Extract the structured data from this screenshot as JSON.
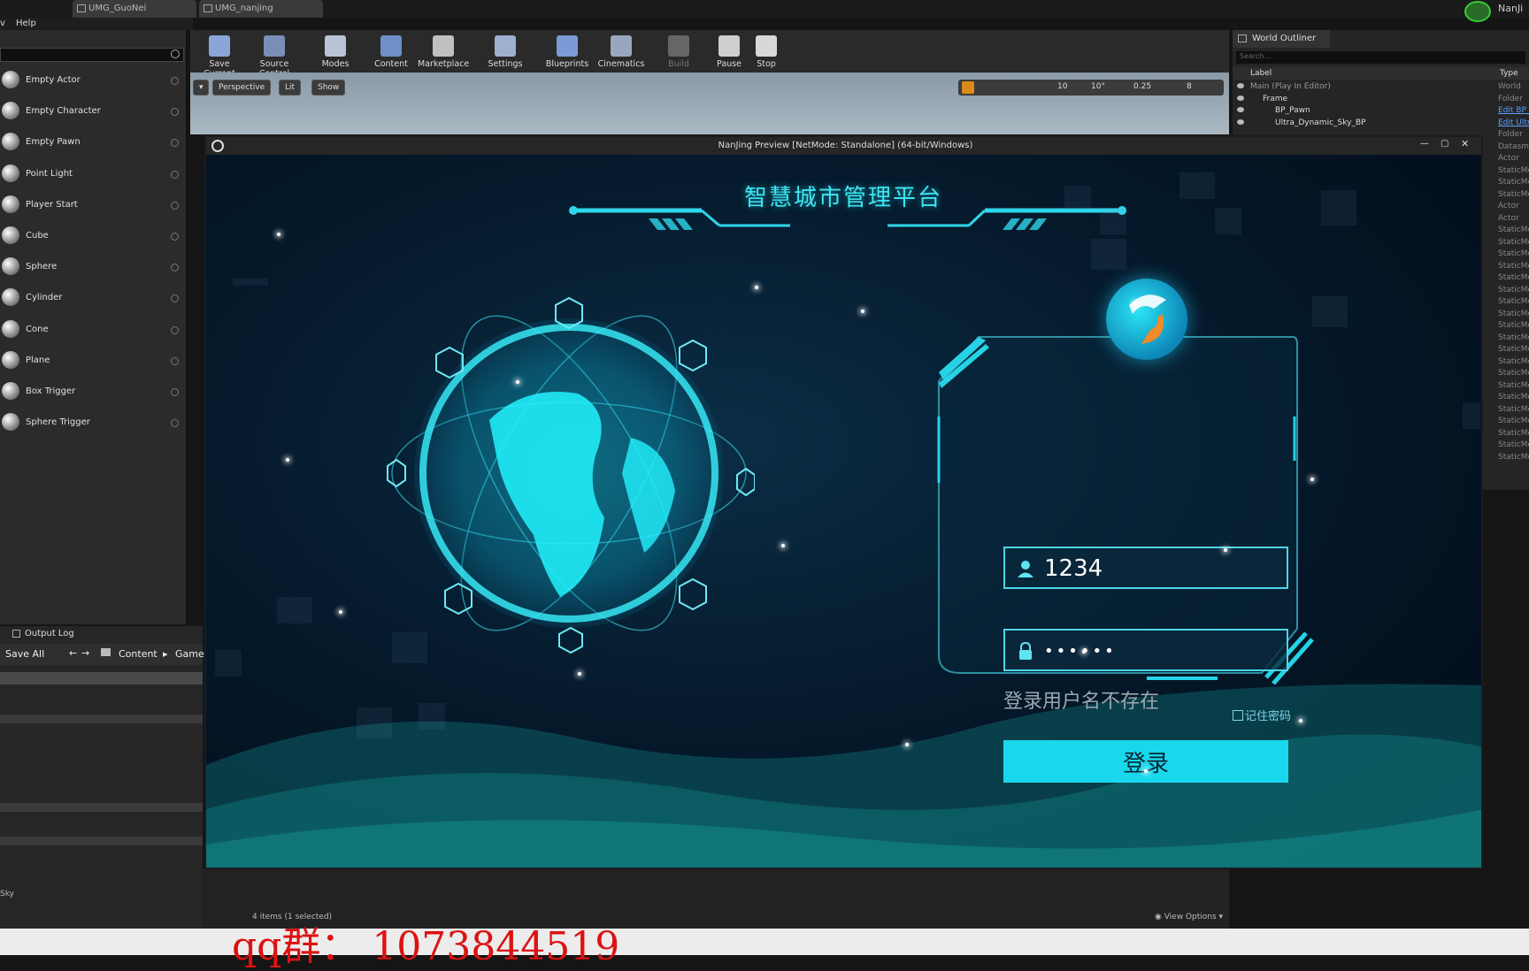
{
  "tabs": [
    "UMG_GuoNei",
    "UMG_nanjing"
  ],
  "top_right_label": "NanJi",
  "menu": [
    "v",
    "Help"
  ],
  "place_items": [
    "Empty Actor",
    "Empty Character",
    "Empty Pawn",
    "Point Light",
    "Player Start",
    "Cube",
    "Sphere",
    "Cylinder",
    "Cone",
    "Plane",
    "Box Trigger",
    "Sphere Trigger"
  ],
  "toolbar": [
    "Save Current",
    "Source Control",
    "Modes",
    "Content",
    "Marketplace",
    "Settings",
    "Blueprints",
    "Cinematics",
    "Build",
    "Pause",
    "Stop"
  ],
  "viewport": {
    "perspective": "Perspective",
    "lit": "Lit",
    "show": "Show",
    "grid": "10",
    "angle": "10°",
    "scale": "0.25",
    "cam": "8"
  },
  "outliner": {
    "tab": "World Outliner",
    "search_placeholder": "Search...",
    "col_label": "Label",
    "col_type": "Type",
    "rows": [
      {
        "label": "Main (Play In Editor)",
        "type": "World"
      },
      {
        "label": "Frame",
        "type": "Folder"
      },
      {
        "label": "BP_Pawn",
        "type": "Edit BP_"
      },
      {
        "label": "Ultra_Dynamic_Sky_BP",
        "type": "Edit Ultr"
      }
    ],
    "extra_types": [
      "Folder",
      "Datasmi",
      "Actor",
      "StaticMe",
      "StaticMe",
      "StaticMe",
      "Actor",
      "Actor",
      "StaticMe",
      "StaticMe",
      "StaticMe",
      "StaticMe",
      "StaticMe",
      "StaticMe",
      "StaticMe",
      "StaticMe",
      "StaticMe",
      "StaticMe",
      "StaticMe",
      "StaticMe",
      "StaticMe",
      "StaticMe",
      "StaticMe",
      "StaticMe",
      "StaticMe",
      "StaticMe",
      "StaticMe",
      "StaticMe"
    ]
  },
  "preview": {
    "title": "NanJing Preview [NetMode: Standalone]  (64-bit/Windows)",
    "platform_title": "智慧城市管理平台",
    "username": "1234",
    "password": "••••••",
    "error": "登录用户名不存在",
    "remember": "记住密码",
    "login_label": "登录"
  },
  "bottom": {
    "output_log": "Output Log",
    "save_all": "Save All",
    "content": "Content",
    "game": "Game",
    "items_count": "4 items (1 selected)",
    "view_options": "View Options",
    "sky": "Sky",
    "watermark": "qq群：  1073844519"
  }
}
